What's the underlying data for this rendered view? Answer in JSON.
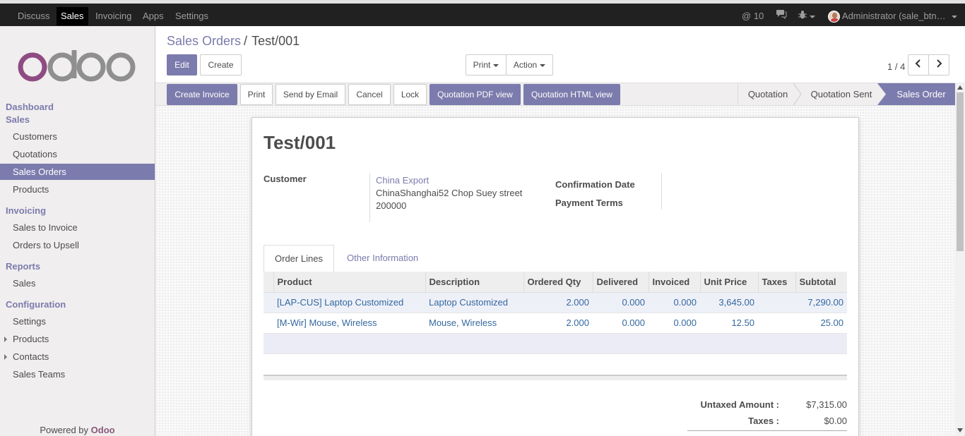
{
  "topbar": {
    "apps": [
      "Discuss",
      "Sales",
      "Invoicing",
      "Apps",
      "Settings"
    ],
    "mentions": "10",
    "user": "Administrator (sale_btn…"
  },
  "sidebar": {
    "logo": "odoo",
    "groups": {
      "dashboard": "Dashboard",
      "sales": "Sales",
      "invoicing": "Invoicing",
      "reports": "Reports",
      "configuration": "Configuration"
    },
    "sales_items": [
      "Customers",
      "Quotations",
      "Sales Orders",
      "Products"
    ],
    "invoicing_items": [
      "Sales to Invoice",
      "Orders to Upsell"
    ],
    "reports_items": [
      "Sales"
    ],
    "config_items": [
      "Settings",
      "Products",
      "Contacts",
      "Sales Teams"
    ],
    "powered_prefix": "Powered by ",
    "powered_brand": "Odoo"
  },
  "breadcrumb": {
    "parent": "Sales Orders",
    "sep": "/",
    "current": "Test/001"
  },
  "controls": {
    "edit": "Edit",
    "create": "Create",
    "print": "Print",
    "action": "Action",
    "pager": "1 / 4"
  },
  "header_buttons": [
    "Create Invoice",
    "Print",
    "Send by Email",
    "Cancel",
    "Lock",
    "Quotation PDF view",
    "Quotation HTML view"
  ],
  "stages": [
    "Quotation",
    "Quotation Sent",
    "Sales Order"
  ],
  "order": {
    "name": "Test/001",
    "customer_label": "Customer",
    "customer_name": "China Export",
    "customer_addr1": "ChinaShanghai52 Chop Suey street",
    "customer_addr2": "200000",
    "confirmation_label": "Confirmation Date",
    "payment_label": "Payment Terms"
  },
  "tabs": [
    "Order Lines",
    "Other Information"
  ],
  "table": {
    "headers": [
      "Product",
      "Description",
      "Ordered Qty",
      "Delivered",
      "Invoiced",
      "Unit Price",
      "Taxes",
      "Subtotal"
    ],
    "rows": [
      [
        "[LAP-CUS] Laptop Customized",
        "Laptop Customized",
        "2.000",
        "0.000",
        "0.000",
        "3,645.00",
        "",
        "7,290.00"
      ],
      [
        "[M-Wir] Mouse, Wireless",
        "Mouse, Wireless",
        "2.000",
        "0.000",
        "0.000",
        "12.50",
        "",
        "25.00"
      ]
    ]
  },
  "totals": {
    "untaxed_label": "Untaxed Amount :",
    "untaxed_value": "$7,315.00",
    "taxes_label": "Taxes :",
    "taxes_value": "$0.00"
  }
}
